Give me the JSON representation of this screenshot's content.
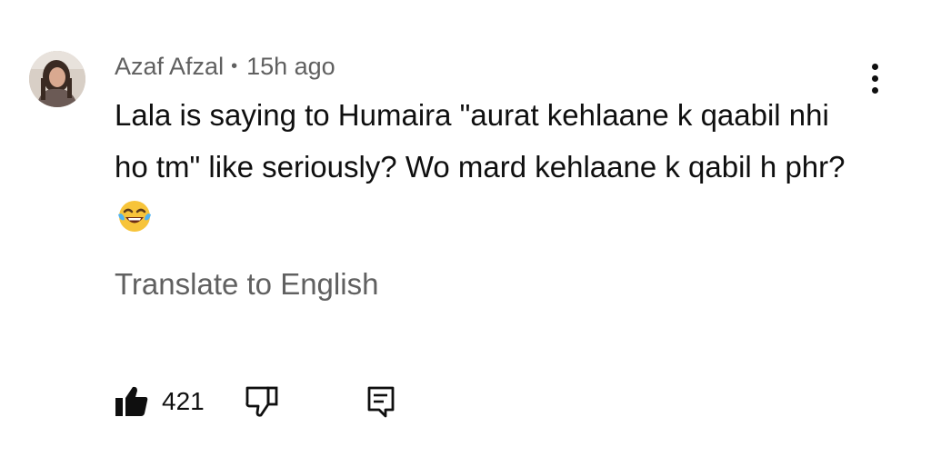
{
  "comment": {
    "author": "Azaf Afzal",
    "separator": "•",
    "time": "15h ago",
    "text": "Lala is saying to Humaira \"aurat kehlaane k qaabil nhi ho tm\" like seriously? Wo mard kehlaane k qabil h phr?",
    "emoji": "joy-tears-emoji",
    "translate_label": "Translate to English",
    "like_count": "421"
  },
  "icons": {
    "more": "more-vertical-icon",
    "like": "thumbs-up-icon",
    "dislike": "thumbs-down-icon",
    "reply": "reply-comment-icon"
  },
  "colors": {
    "primary_text": "#0f0f0f",
    "secondary_text": "#606060",
    "emoji_yellow": "#f7c43a",
    "tear_blue": "#4fb3f2"
  }
}
